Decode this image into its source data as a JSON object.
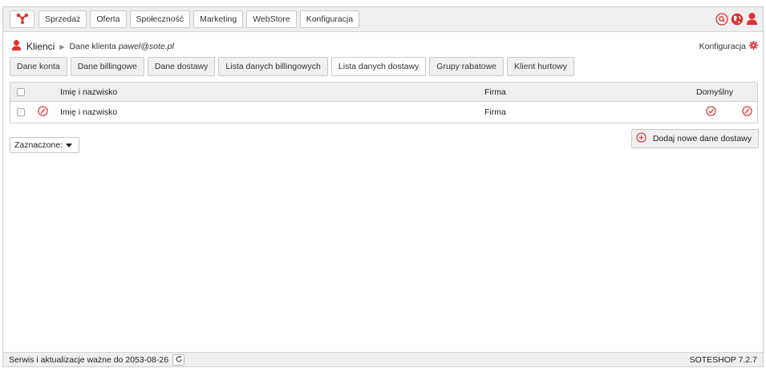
{
  "colors": {
    "accent": "#e03232",
    "chrome": "#efefef",
    "border": "#c9c9c9"
  },
  "nav": {
    "logo_icon": "share-network-icon",
    "items": [
      "Sprzedaż",
      "Oferta",
      "Społeczność",
      "Marketing",
      "WebStore",
      "Konfiguracja"
    ],
    "right_icons": [
      "search-icon",
      "globe-icon",
      "user-icon"
    ]
  },
  "breadcrumb": {
    "icon": "user-icon",
    "main": "Klienci",
    "sub_prefix": "Dane klienta",
    "sub_email": "pawel@sote.pl"
  },
  "config_link": {
    "label": "Konfiguracja",
    "icon": "gear-icon"
  },
  "tabs": [
    {
      "label": "Dane konta",
      "active": false
    },
    {
      "label": "Dane billingowe",
      "active": false
    },
    {
      "label": "Dane dostawy",
      "active": false
    },
    {
      "label": "Lista danych billingowych",
      "active": false
    },
    {
      "label": "Lista danych dostawy",
      "active": true
    },
    {
      "label": "Grupy rabatowe",
      "active": false
    },
    {
      "label": "Klient hurtowy",
      "active": false
    }
  ],
  "table": {
    "headers": {
      "name": "Imię i nazwisko",
      "firma": "Firma",
      "default": "Domyślny"
    },
    "rows": [
      {
        "name": "Imię i nazwisko",
        "firma": "Firma",
        "default_icon": "check-circle-icon",
        "edit_icon": "edit-icon"
      }
    ]
  },
  "selected_action": {
    "value": "Zaznaczone:"
  },
  "add_button": {
    "label": "Dodaj nowe dane dostawy",
    "icon": "plus-circle-icon"
  },
  "footer": {
    "left": "Serwis i aktualizacje ważne do 2053-08-26",
    "refresh_icon": "refresh-icon",
    "right": "SOTESHOP 7.2.7"
  }
}
